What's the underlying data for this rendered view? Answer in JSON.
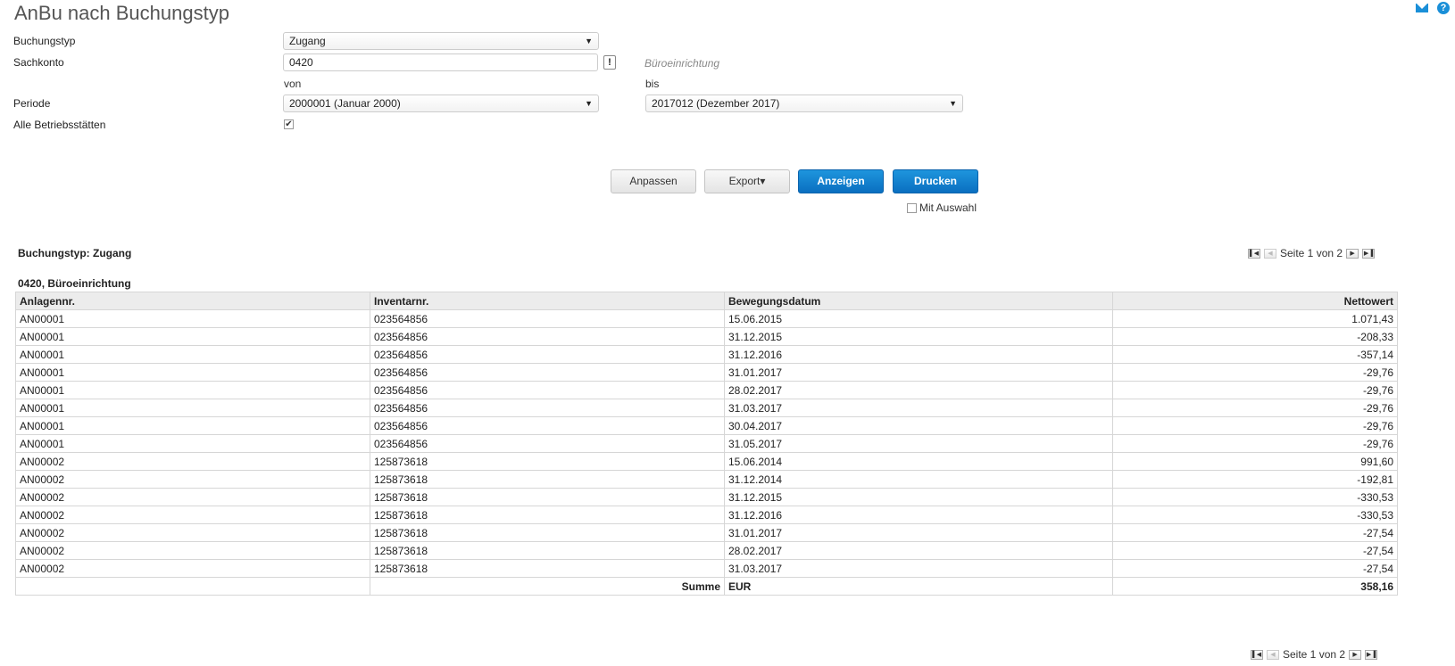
{
  "page": {
    "title": "AnBu nach Buchungstyp"
  },
  "form": {
    "buchungstyp_label": "Buchungstyp",
    "buchungstyp_value": "Zugang",
    "sachkonto_label": "Sachkonto",
    "sachkonto_value": "0420",
    "sachkonto_hint": "Büroeinrichtung",
    "von_label": "von",
    "bis_label": "bis",
    "periode_label": "Periode",
    "periode_von": "2000001 (Januar 2000)",
    "periode_bis": "2017012 (Dezember 2017)",
    "alle_label": "Alle Betriebsstätten",
    "alle_checked": true,
    "excl": "!"
  },
  "buttons": {
    "anpassen": "Anpassen",
    "export": "Export▾",
    "anzeigen": "Anzeigen",
    "drucken": "Drucken",
    "mit_auswahl": "Mit Auswahl"
  },
  "report": {
    "section": "Buchungstyp: Zugang",
    "group": "0420, Büroeinrichtung",
    "pager_top": "Seite 1 von 2",
    "pager_bottom": "Seite 1 von 2",
    "columns": [
      "Anlagennr.",
      "Inventarnr.",
      "Bewegungsdatum",
      "Nettowert"
    ],
    "rows": [
      [
        "AN00001",
        "023564856",
        "15.06.2015",
        "1.071,43"
      ],
      [
        "AN00001",
        "023564856",
        "31.12.2015",
        "-208,33"
      ],
      [
        "AN00001",
        "023564856",
        "31.12.2016",
        "-357,14"
      ],
      [
        "AN00001",
        "023564856",
        "31.01.2017",
        "-29,76"
      ],
      [
        "AN00001",
        "023564856",
        "28.02.2017",
        "-29,76"
      ],
      [
        "AN00001",
        "023564856",
        "31.03.2017",
        "-29,76"
      ],
      [
        "AN00001",
        "023564856",
        "30.04.2017",
        "-29,76"
      ],
      [
        "AN00001",
        "023564856",
        "31.05.2017",
        "-29,76"
      ],
      [
        "AN00002",
        "125873618",
        "15.06.2014",
        "991,60"
      ],
      [
        "AN00002",
        "125873618",
        "31.12.2014",
        "-192,81"
      ],
      [
        "AN00002",
        "125873618",
        "31.12.2015",
        "-330,53"
      ],
      [
        "AN00002",
        "125873618",
        "31.12.2016",
        "-330,53"
      ],
      [
        "AN00002",
        "125873618",
        "31.01.2017",
        "-27,54"
      ],
      [
        "AN00002",
        "125873618",
        "28.02.2017",
        "-27,54"
      ],
      [
        "AN00002",
        "125873618",
        "31.03.2017",
        "-27,54"
      ]
    ],
    "sum_label": "Summe",
    "sum_currency": "EUR",
    "sum_value": "358,16"
  },
  "icons": {
    "mail": "mail-icon",
    "help": "help-icon"
  },
  "colors": {
    "accent": "#0a6fc0",
    "header_bg": "#ececec"
  }
}
